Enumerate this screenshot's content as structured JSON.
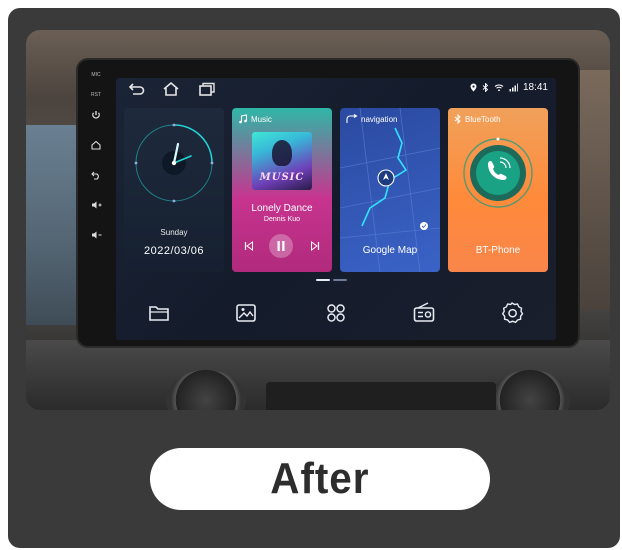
{
  "status_bar": {
    "time": "18:41",
    "icons": [
      "location-icon",
      "bluetooth-icon",
      "wifi-icon",
      "signal-icon"
    ]
  },
  "side_buttons": {
    "mic_label": "MIC",
    "rst_label": "RST"
  },
  "cards": {
    "clock": {
      "day": "Sunday",
      "date": "2022/03/06"
    },
    "music": {
      "title": "Music",
      "album_art_text": "MUSIC",
      "song": "Lonely Dance",
      "artist": "Dennis Kuo"
    },
    "navigation": {
      "title": "navigation",
      "app_label": "Google Map"
    },
    "bluetooth": {
      "title": "BlueTooth",
      "app_label": "BT-Phone"
    }
  },
  "dock": {
    "icons": [
      "folder-icon",
      "gallery-icon",
      "apps-grid-icon",
      "radio-icon",
      "settings-icon"
    ]
  },
  "page_indicator": {
    "pages": 2,
    "active": 0
  },
  "caption": {
    "text": "After"
  },
  "colors": {
    "outer_frame": "#3a3a3a",
    "screen_bg": "#161d2d",
    "music_card": "#c7348f",
    "nav_card": "#3a63c7",
    "bt_card": "#ff8a3a",
    "clock_accent": "#22d3d3"
  }
}
